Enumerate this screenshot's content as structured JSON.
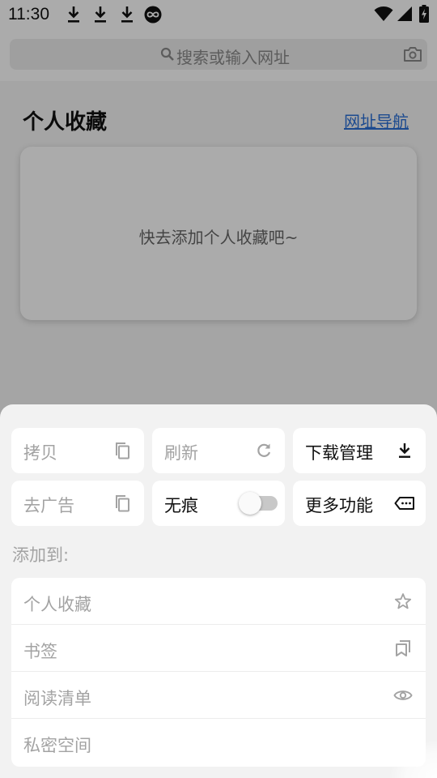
{
  "status_bar": {
    "time": "11:30",
    "icons": [
      "download-icon",
      "download-icon",
      "download-icon",
      "infinity-icon",
      "wifi-icon",
      "signal-icon",
      "battery-charging-icon"
    ]
  },
  "background_page": {
    "search": {
      "placeholder": "搜索或输入网址",
      "icon": "search-icon",
      "right_icon": "camera-icon"
    },
    "section_title": "个人收藏",
    "nav_link": "网址导航",
    "empty_message": "快去添加个人收藏吧~"
  },
  "menu": {
    "tiles": [
      {
        "label": "拷贝",
        "icon": "copy-icon",
        "enabled": false
      },
      {
        "label": "刷新",
        "icon": "refresh-icon",
        "enabled": false
      },
      {
        "label": "下载管理",
        "icon": "download-icon",
        "enabled": true
      },
      {
        "label": "去广告",
        "icon": "copy-icon",
        "enabled": false
      },
      {
        "label": "无痕",
        "control": "toggle",
        "toggle_on": false,
        "enabled": true
      },
      {
        "label": "更多功能",
        "icon": "more-tag-icon",
        "enabled": true
      }
    ],
    "add_to_label": "添加到:",
    "add_to_items": [
      {
        "label": "个人收藏",
        "icon": "star-icon"
      },
      {
        "label": "书签",
        "icon": "bookmark-icon"
      },
      {
        "label": "阅读清单",
        "icon": "eye-icon"
      },
      {
        "label": "私密空间",
        "icon": ""
      }
    ]
  },
  "colors": {
    "link": "#2a6fd6",
    "sheet_bg": "#f2f2f2",
    "disabled_text": "#a3a3a3",
    "enabled_text": "#111111",
    "overlay": "rgba(0,0,0,0.33)"
  }
}
